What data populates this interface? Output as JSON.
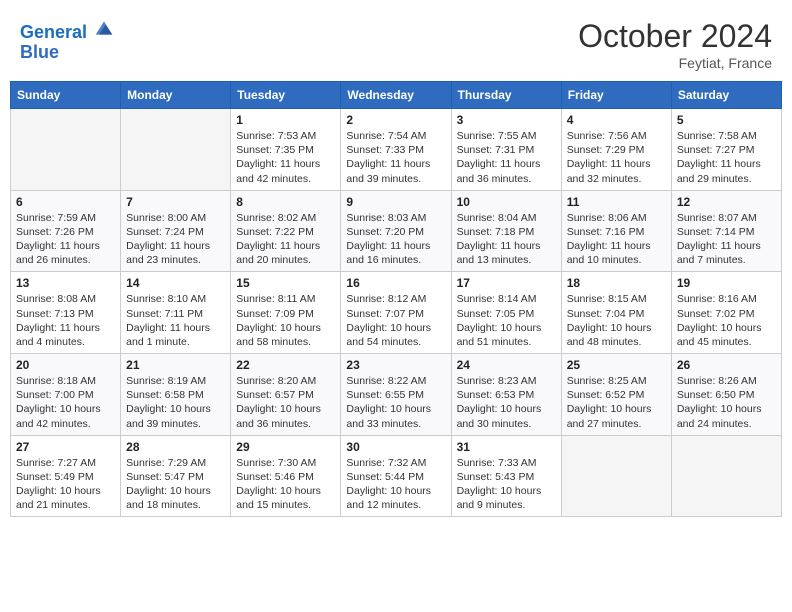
{
  "header": {
    "logo_line1": "General",
    "logo_line2": "Blue",
    "month": "October 2024",
    "location": "Feytiat, France"
  },
  "days_of_week": [
    "Sunday",
    "Monday",
    "Tuesday",
    "Wednesday",
    "Thursday",
    "Friday",
    "Saturday"
  ],
  "weeks": [
    [
      {
        "day": "",
        "empty": true
      },
      {
        "day": "",
        "empty": true
      },
      {
        "day": "1",
        "sunrise": "Sunrise: 7:53 AM",
        "sunset": "Sunset: 7:35 PM",
        "daylight": "Daylight: 11 hours and 42 minutes."
      },
      {
        "day": "2",
        "sunrise": "Sunrise: 7:54 AM",
        "sunset": "Sunset: 7:33 PM",
        "daylight": "Daylight: 11 hours and 39 minutes."
      },
      {
        "day": "3",
        "sunrise": "Sunrise: 7:55 AM",
        "sunset": "Sunset: 7:31 PM",
        "daylight": "Daylight: 11 hours and 36 minutes."
      },
      {
        "day": "4",
        "sunrise": "Sunrise: 7:56 AM",
        "sunset": "Sunset: 7:29 PM",
        "daylight": "Daylight: 11 hours and 32 minutes."
      },
      {
        "day": "5",
        "sunrise": "Sunrise: 7:58 AM",
        "sunset": "Sunset: 7:27 PM",
        "daylight": "Daylight: 11 hours and 29 minutes."
      }
    ],
    [
      {
        "day": "6",
        "sunrise": "Sunrise: 7:59 AM",
        "sunset": "Sunset: 7:26 PM",
        "daylight": "Daylight: 11 hours and 26 minutes."
      },
      {
        "day": "7",
        "sunrise": "Sunrise: 8:00 AM",
        "sunset": "Sunset: 7:24 PM",
        "daylight": "Daylight: 11 hours and 23 minutes."
      },
      {
        "day": "8",
        "sunrise": "Sunrise: 8:02 AM",
        "sunset": "Sunset: 7:22 PM",
        "daylight": "Daylight: 11 hours and 20 minutes."
      },
      {
        "day": "9",
        "sunrise": "Sunrise: 8:03 AM",
        "sunset": "Sunset: 7:20 PM",
        "daylight": "Daylight: 11 hours and 16 minutes."
      },
      {
        "day": "10",
        "sunrise": "Sunrise: 8:04 AM",
        "sunset": "Sunset: 7:18 PM",
        "daylight": "Daylight: 11 hours and 13 minutes."
      },
      {
        "day": "11",
        "sunrise": "Sunrise: 8:06 AM",
        "sunset": "Sunset: 7:16 PM",
        "daylight": "Daylight: 11 hours and 10 minutes."
      },
      {
        "day": "12",
        "sunrise": "Sunrise: 8:07 AM",
        "sunset": "Sunset: 7:14 PM",
        "daylight": "Daylight: 11 hours and 7 minutes."
      }
    ],
    [
      {
        "day": "13",
        "sunrise": "Sunrise: 8:08 AM",
        "sunset": "Sunset: 7:13 PM",
        "daylight": "Daylight: 11 hours and 4 minutes."
      },
      {
        "day": "14",
        "sunrise": "Sunrise: 8:10 AM",
        "sunset": "Sunset: 7:11 PM",
        "daylight": "Daylight: 11 hours and 1 minute."
      },
      {
        "day": "15",
        "sunrise": "Sunrise: 8:11 AM",
        "sunset": "Sunset: 7:09 PM",
        "daylight": "Daylight: 10 hours and 58 minutes."
      },
      {
        "day": "16",
        "sunrise": "Sunrise: 8:12 AM",
        "sunset": "Sunset: 7:07 PM",
        "daylight": "Daylight: 10 hours and 54 minutes."
      },
      {
        "day": "17",
        "sunrise": "Sunrise: 8:14 AM",
        "sunset": "Sunset: 7:05 PM",
        "daylight": "Daylight: 10 hours and 51 minutes."
      },
      {
        "day": "18",
        "sunrise": "Sunrise: 8:15 AM",
        "sunset": "Sunset: 7:04 PM",
        "daylight": "Daylight: 10 hours and 48 minutes."
      },
      {
        "day": "19",
        "sunrise": "Sunrise: 8:16 AM",
        "sunset": "Sunset: 7:02 PM",
        "daylight": "Daylight: 10 hours and 45 minutes."
      }
    ],
    [
      {
        "day": "20",
        "sunrise": "Sunrise: 8:18 AM",
        "sunset": "Sunset: 7:00 PM",
        "daylight": "Daylight: 10 hours and 42 minutes."
      },
      {
        "day": "21",
        "sunrise": "Sunrise: 8:19 AM",
        "sunset": "Sunset: 6:58 PM",
        "daylight": "Daylight: 10 hours and 39 minutes."
      },
      {
        "day": "22",
        "sunrise": "Sunrise: 8:20 AM",
        "sunset": "Sunset: 6:57 PM",
        "daylight": "Daylight: 10 hours and 36 minutes."
      },
      {
        "day": "23",
        "sunrise": "Sunrise: 8:22 AM",
        "sunset": "Sunset: 6:55 PM",
        "daylight": "Daylight: 10 hours and 33 minutes."
      },
      {
        "day": "24",
        "sunrise": "Sunrise: 8:23 AM",
        "sunset": "Sunset: 6:53 PM",
        "daylight": "Daylight: 10 hours and 30 minutes."
      },
      {
        "day": "25",
        "sunrise": "Sunrise: 8:25 AM",
        "sunset": "Sunset: 6:52 PM",
        "daylight": "Daylight: 10 hours and 27 minutes."
      },
      {
        "day": "26",
        "sunrise": "Sunrise: 8:26 AM",
        "sunset": "Sunset: 6:50 PM",
        "daylight": "Daylight: 10 hours and 24 minutes."
      }
    ],
    [
      {
        "day": "27",
        "sunrise": "Sunrise: 7:27 AM",
        "sunset": "Sunset: 5:49 PM",
        "daylight": "Daylight: 10 hours and 21 minutes."
      },
      {
        "day": "28",
        "sunrise": "Sunrise: 7:29 AM",
        "sunset": "Sunset: 5:47 PM",
        "daylight": "Daylight: 10 hours and 18 minutes."
      },
      {
        "day": "29",
        "sunrise": "Sunrise: 7:30 AM",
        "sunset": "Sunset: 5:46 PM",
        "daylight": "Daylight: 10 hours and 15 minutes."
      },
      {
        "day": "30",
        "sunrise": "Sunrise: 7:32 AM",
        "sunset": "Sunset: 5:44 PM",
        "daylight": "Daylight: 10 hours and 12 minutes."
      },
      {
        "day": "31",
        "sunrise": "Sunrise: 7:33 AM",
        "sunset": "Sunset: 5:43 PM",
        "daylight": "Daylight: 10 hours and 9 minutes."
      },
      {
        "day": "",
        "empty": true
      },
      {
        "day": "",
        "empty": true
      }
    ]
  ]
}
